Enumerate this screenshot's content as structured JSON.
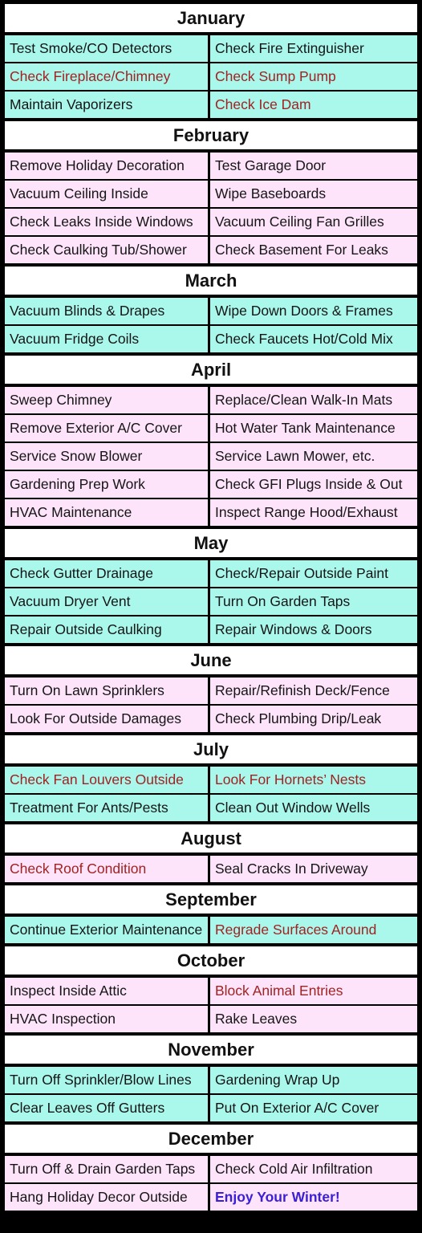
{
  "colors": {
    "cyan": "#aaf8ec",
    "pink": "#fde4fa",
    "red_text": "#a12222",
    "blue_text": "#3a1fd4"
  },
  "months": [
    {
      "name": "January",
      "bg": "cyan",
      "rows": [
        [
          {
            "text": "Test Smoke/CO Detectors"
          },
          {
            "text": "Check Fire Extinguisher"
          }
        ],
        [
          {
            "text": "Check Fireplace/Chimney",
            "style": "red"
          },
          {
            "text": "Check Sump Pump",
            "style": "red"
          }
        ],
        [
          {
            "text": "Maintain Vaporizers"
          },
          {
            "text": "Check Ice Dam",
            "style": "red"
          }
        ]
      ]
    },
    {
      "name": "February",
      "bg": "pink",
      "rows": [
        [
          {
            "text": "Remove Holiday Decoration"
          },
          {
            "text": "Test Garage Door"
          }
        ],
        [
          {
            "text": "Vacuum Ceiling Inside"
          },
          {
            "text": "Wipe Baseboards"
          }
        ],
        [
          {
            "text": "Check Leaks Inside Windows"
          },
          {
            "text": "Vacuum Ceiling Fan Grilles"
          }
        ],
        [
          {
            "text": "Check Caulking Tub/Shower"
          },
          {
            "text": "Check Basement For Leaks"
          }
        ]
      ]
    },
    {
      "name": "March",
      "bg": "cyan",
      "rows": [
        [
          {
            "text": "Vacuum Blinds & Drapes"
          },
          {
            "text": "Wipe Down Doors & Frames"
          }
        ],
        [
          {
            "text": "Vacuum Fridge Coils"
          },
          {
            "text": "Check Faucets Hot/Cold Mix"
          }
        ]
      ]
    },
    {
      "name": "April",
      "bg": "pink",
      "rows": [
        [
          {
            "text": "Sweep Chimney"
          },
          {
            "text": "Replace/Clean Walk-In Mats"
          }
        ],
        [
          {
            "text": "Remove Exterior A/C Cover"
          },
          {
            "text": "Hot Water Tank Maintenance"
          }
        ],
        [
          {
            "text": "Service Snow Blower"
          },
          {
            "text": "Service Lawn Mower, etc."
          }
        ],
        [
          {
            "text": "Gardening Prep Work"
          },
          {
            "text": "Check GFI Plugs Inside & Out"
          }
        ],
        [
          {
            "text": "HVAC Maintenance"
          },
          {
            "text": "Inspect Range Hood/Exhaust"
          }
        ]
      ]
    },
    {
      "name": "May",
      "bg": "cyan",
      "rows": [
        [
          {
            "text": "Check Gutter Drainage"
          },
          {
            "text": "Check/Repair Outside Paint"
          }
        ],
        [
          {
            "text": "Vacuum Dryer Vent"
          },
          {
            "text": "Turn On Garden Taps"
          }
        ],
        [
          {
            "text": "Repair Outside Caulking"
          },
          {
            "text": "Repair Windows & Doors"
          }
        ]
      ]
    },
    {
      "name": "June",
      "bg": "pink",
      "rows": [
        [
          {
            "text": "Turn On Lawn Sprinklers"
          },
          {
            "text": "Repair/Refinish Deck/Fence"
          }
        ],
        [
          {
            "text": "Look For Outside Damages"
          },
          {
            "text": "Check Plumbing Drip/Leak"
          }
        ]
      ]
    },
    {
      "name": "July",
      "bg": "cyan",
      "rows": [
        [
          {
            "text": "Check Fan Louvers Outside",
            "style": "red"
          },
          {
            "text": "Look For Hornets’ Nests",
            "style": "red"
          }
        ],
        [
          {
            "text": "Treatment For Ants/Pests"
          },
          {
            "text": "Clean Out Window Wells"
          }
        ]
      ]
    },
    {
      "name": "August",
      "bg": "pink",
      "rows": [
        [
          {
            "text": "Check Roof Condition",
            "style": "red"
          },
          {
            "text": "Seal Cracks In Driveway"
          }
        ]
      ]
    },
    {
      "name": "September",
      "bg": "cyan",
      "rows": [
        [
          {
            "text": "Continue Exterior Maintenance"
          },
          {
            "text": "Regrade Surfaces Around",
            "style": "red"
          }
        ]
      ]
    },
    {
      "name": "October",
      "bg": "pink",
      "rows": [
        [
          {
            "text": "Inspect Inside Attic"
          },
          {
            "text": "Block Animal Entries",
            "style": "red"
          }
        ],
        [
          {
            "text": "HVAC Inspection"
          },
          {
            "text": "Rake Leaves"
          }
        ]
      ]
    },
    {
      "name": "November",
      "bg": "cyan",
      "rows": [
        [
          {
            "text": "Turn Off Sprinkler/Blow Lines"
          },
          {
            "text": "Gardening Wrap Up"
          }
        ],
        [
          {
            "text": "Clear Leaves Off Gutters"
          },
          {
            "text": "Put On Exterior A/C Cover"
          }
        ]
      ]
    },
    {
      "name": "December",
      "bg": "pink",
      "rows": [
        [
          {
            "text": "Turn Off & Drain Garden Taps"
          },
          {
            "text": "Check Cold Air Infiltration"
          }
        ],
        [
          {
            "text": "Hang Holiday Decor Outside"
          },
          {
            "text": "Enjoy Your Winter!",
            "style": "blue"
          }
        ]
      ]
    }
  ]
}
